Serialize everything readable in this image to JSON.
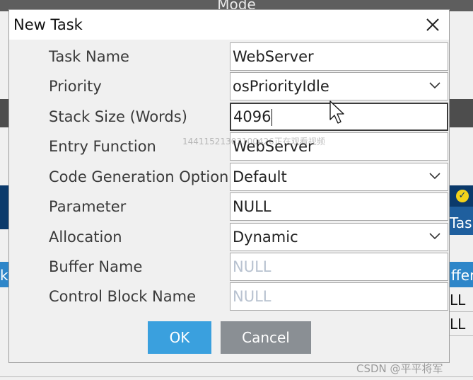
{
  "background": {
    "mode_label": "Mode",
    "right_edge_texts": [
      "Tas",
      "ffer",
      "LL",
      "LL"
    ],
    "left_edge_text": "k"
  },
  "dialog": {
    "title": "New Task",
    "fields": [
      {
        "label": "Task Name",
        "value": "WebServer",
        "type": "text"
      },
      {
        "label": "Priority",
        "value": "osPriorityIdle",
        "type": "select"
      },
      {
        "label": "Stack Size (Words)",
        "value": "4096",
        "type": "text",
        "focused": true
      },
      {
        "label": "Entry Function",
        "value": "WebServer",
        "type": "text"
      },
      {
        "label": "Code Generation Option",
        "value": "Default",
        "type": "select"
      },
      {
        "label": "Parameter",
        "value": "NULL",
        "type": "text"
      },
      {
        "label": "Allocation",
        "value": "Dynamic",
        "type": "select"
      },
      {
        "label": "Buffer Name",
        "value": "NULL",
        "type": "text",
        "disabled": true
      },
      {
        "label": "Control Block Name",
        "value": "NULL",
        "type": "text",
        "disabled": true
      }
    ],
    "ok_label": "OK",
    "cancel_label": "Cancel"
  },
  "overlay": {
    "watermark": "14411521303100426正在观看视频",
    "credit": "CSDN @平平将军"
  },
  "colors": {
    "ok_button": "#3aa0de",
    "cancel_button": "#8a8f94",
    "disabled_text": "#b8c2d0"
  },
  "icons": {
    "close": "close-icon",
    "dropdown": "chevron-down-icon",
    "mouse_cursor": "cursor-arrow-icon"
  }
}
